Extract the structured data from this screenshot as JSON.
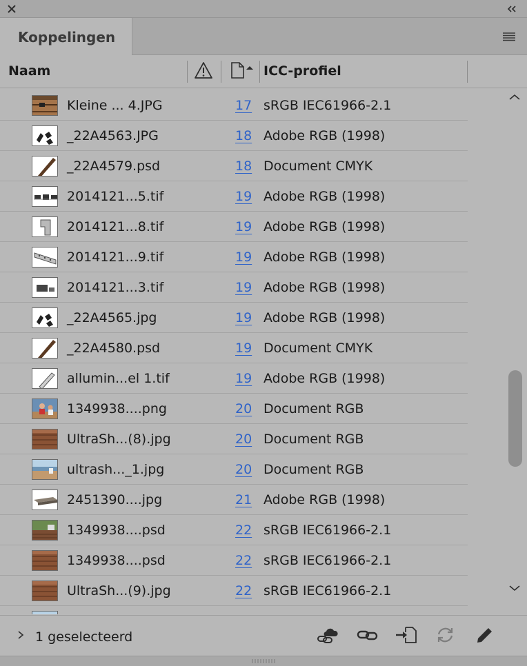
{
  "panel": {
    "tab_label": "Koppelingen"
  },
  "columns": {
    "name": "Naam",
    "icc": "ICC-profiel"
  },
  "rows": [
    {
      "name": "Kleine ... 4.JPG",
      "page": "17",
      "icc": "sRGB IEC61966-2.1",
      "thumb": "wood-deck"
    },
    {
      "name": "_22A4563.JPG",
      "page": "18",
      "icc": "Adobe RGB (1998)",
      "thumb": "clips"
    },
    {
      "name": "_22A4579.psd",
      "page": "18",
      "icc": "Document CMYK",
      "thumb": "board-diagonal"
    },
    {
      "name": "2014121...5.tif",
      "page": "19",
      "icc": "Adobe RGB (1998)",
      "thumb": "brackets"
    },
    {
      "name": "2014121...8.tif",
      "page": "19",
      "icc": "Adobe RGB (1998)",
      "thumb": "bracket-single"
    },
    {
      "name": "2014121...9.tif",
      "page": "19",
      "icc": "Adobe RGB (1998)",
      "thumb": "rail"
    },
    {
      "name": "2014121...3.tif",
      "page": "19",
      "icc": "Adobe RGB (1998)",
      "thumb": "bracket-small"
    },
    {
      "name": "_22A4565.jpg",
      "page": "19",
      "icc": "Adobe RGB (1998)",
      "thumb": "clips"
    },
    {
      "name": "_22A4580.psd",
      "page": "19",
      "icc": "Document CMYK",
      "thumb": "board-diagonal"
    },
    {
      "name": "allumin...el 1.tif",
      "page": "19",
      "icc": "Adobe RGB (1998)",
      "thumb": "profile"
    },
    {
      "name": "1349938....png",
      "page": "20",
      "icc": "Document RGB",
      "thumb": "people"
    },
    {
      "name": "UltraSh...(8).jpg",
      "page": "20",
      "icc": "Document RGB",
      "thumb": "deck-brown"
    },
    {
      "name": "ultrash..._1.jpg",
      "page": "20",
      "icc": "Document RGB",
      "thumb": "deck-sea"
    },
    {
      "name": "2451390....jpg",
      "page": "21",
      "icc": "Adobe RGB (1998)",
      "thumb": "board-grey"
    },
    {
      "name": "1349938....psd",
      "page": "22",
      "icc": "sRGB IEC61966-2.1",
      "thumb": "deck-garden"
    },
    {
      "name": "1349938....psd",
      "page": "22",
      "icc": "sRGB IEC61966-2.1",
      "thumb": "deck-brown"
    },
    {
      "name": "UltraSh...(9).jpg",
      "page": "22",
      "icc": "sRGB IEC61966-2.1",
      "thumb": "deck-brown"
    },
    {
      "name": "",
      "page": "",
      "icc": "",
      "thumb": "deck-sea"
    }
  ],
  "footer": {
    "status": "1 geselecteerd"
  },
  "icons": {
    "close": "close-icon",
    "collapse": "double-chevron-left-icon",
    "menu": "hamburger-menu-icon",
    "warning": "warning-triangle-icon",
    "page": "page-sort-icon",
    "cloud_link": "cloud-link-icon",
    "relink": "link-icon",
    "goto": "goto-link-icon",
    "update": "update-link-icon",
    "edit": "edit-original-icon"
  },
  "colors": {
    "panel_bg": "#b8b8b8",
    "page_link": "#2f63c9"
  }
}
